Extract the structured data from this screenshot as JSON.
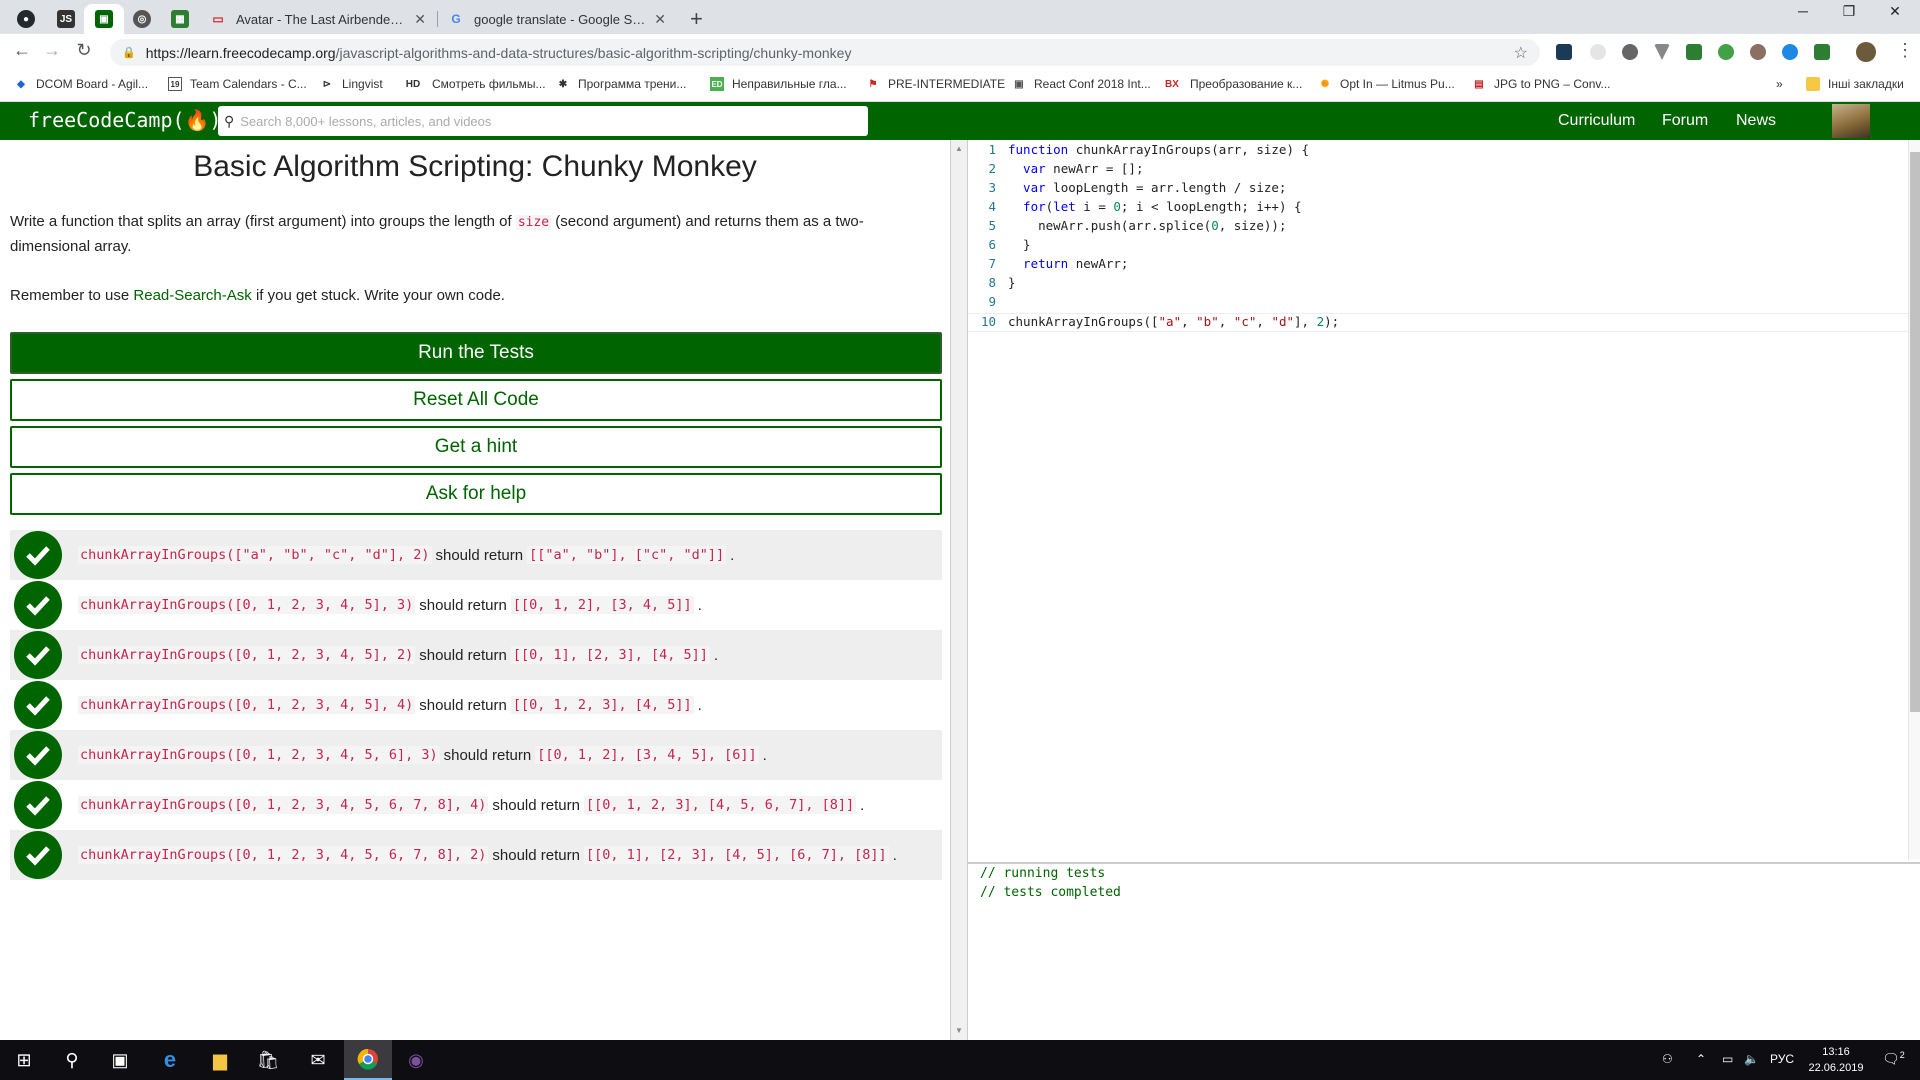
{
  "browser": {
    "tabs": [
      {
        "title": "Avatar - The Last Airbender / Ав"
      },
      {
        "title": "google translate - Google Search"
      }
    ],
    "url_host": "https://learn.freecodecamp.org",
    "url_path": "/javascript-algorithms-and-data-structures/basic-algorithm-scripting/chunky-monkey",
    "bookmarks": [
      "DCOM Board - Agil...",
      "Team Calendars - C...",
      "Lingvist",
      "Смотреть фильмы...",
      "Программа трени...",
      "Неправильные гла...",
      "PRE-INTERMEDIATE",
      "React Conf 2018 Int...",
      "Преобразование к...",
      "Opt In — Litmus Pu...",
      "JPG to PNG – Conv...",
      "Інші закладки"
    ],
    "bookmark_prefixes": {
      "hd": "HD",
      "bx": "BX"
    }
  },
  "fcc": {
    "logo": "freeCodeCamp(🔥)",
    "search_placeholder": "Search 8,000+ lessons, articles, and videos",
    "nav": [
      "Curriculum",
      "Forum",
      "News"
    ]
  },
  "challenge": {
    "title": "Basic Algorithm Scripting: Chunky Monkey",
    "desc_a": "Write a function that splits an array (first argument) into groups the length of ",
    "desc_code": "size",
    "desc_b": " (second argument) and returns them as a two-dimensional array.",
    "remember_a": "Remember to use ",
    "remember_link": "Read-Search-Ask",
    "remember_b": " if you get stuck. Write your own code."
  },
  "buttons": {
    "run": "Run the Tests",
    "reset": "Reset All Code",
    "hint": "Get a hint",
    "help": "Ask for help"
  },
  "tests": [
    {
      "call": "chunkArrayInGroups([\"a\", \"b\", \"c\", \"d\"], 2)",
      "mid": "should return",
      "expected": "[[\"a\", \"b\"], [\"c\", \"d\"]]",
      "end": "."
    },
    {
      "call": "chunkArrayInGroups([0, 1, 2, 3, 4, 5], 3)",
      "mid": "should return",
      "expected": "[[0, 1, 2], [3, 4, 5]]",
      "end": "."
    },
    {
      "call": "chunkArrayInGroups([0, 1, 2, 3, 4, 5], 2)",
      "mid": "should return",
      "expected": "[[0, 1], [2, 3], [4, 5]]",
      "end": "."
    },
    {
      "call": "chunkArrayInGroups([0, 1, 2, 3, 4, 5], 4)",
      "mid": "should return",
      "expected": "[[0, 1, 2, 3], [4, 5]]",
      "end": "."
    },
    {
      "call": "chunkArrayInGroups([0, 1, 2, 3, 4, 5, 6], 3)",
      "mid": "should return",
      "expected": "[[0, 1, 2], [3, 4, 5], [6]]",
      "end": "."
    },
    {
      "call": "chunkArrayInGroups([0, 1, 2, 3, 4, 5, 6, 7, 8], 4)",
      "mid": "should return",
      "expected": "[[0, 1, 2, 3], [4, 5, 6, 7], [8]]",
      "end": "."
    },
    {
      "call": "chunkArrayInGroups([0, 1, 2, 3, 4, 5, 6, 7, 8], 2)",
      "mid": "should return",
      "expected": "[[0, 1], [2, 3], [4, 5], [6, 7], [8]]",
      "end": "."
    }
  ],
  "editor": {
    "line_numbers": [
      "1",
      "2",
      "3",
      "4",
      "5",
      "6",
      "7",
      "8",
      "9",
      "10"
    ],
    "code": {
      "l1_kw": "function",
      "l1_rest": " chunkArrayInGroups(arr, size) {",
      "l2_kw": "  var",
      "l2_rest": " newArr = [];",
      "l3_kw": "  var",
      "l3_rest": " loopLength = arr.length / size;",
      "l4_kw": "  for",
      "l4_a": "(",
      "l4_kw2": "let",
      "l4_b": " i = ",
      "l4_n0": "0",
      "l4_c": "; i < loopLength; i++) {",
      "l5_a": "    newArr.push(arr.splice(",
      "l5_n0": "0",
      "l5_b": ", size));",
      "l6": "  }",
      "l7_kw": "  return",
      "l7_rest": " newArr;",
      "l8": "}",
      "l10_a": "chunkArrayInGroups([",
      "l10_s1": "\"a\"",
      "l10_s2": "\"b\"",
      "l10_s3": "\"c\"",
      "l10_s4": "\"d\"",
      "l10_b": "], ",
      "l10_n": "2",
      "l10_c": ");",
      "comma": ", "
    }
  },
  "console": [
    "// running tests",
    "// tests completed"
  ],
  "taskbar": {
    "time": "13:16",
    "date": "22.06.2019",
    "lang": "РУС",
    "notif_count": "2"
  }
}
